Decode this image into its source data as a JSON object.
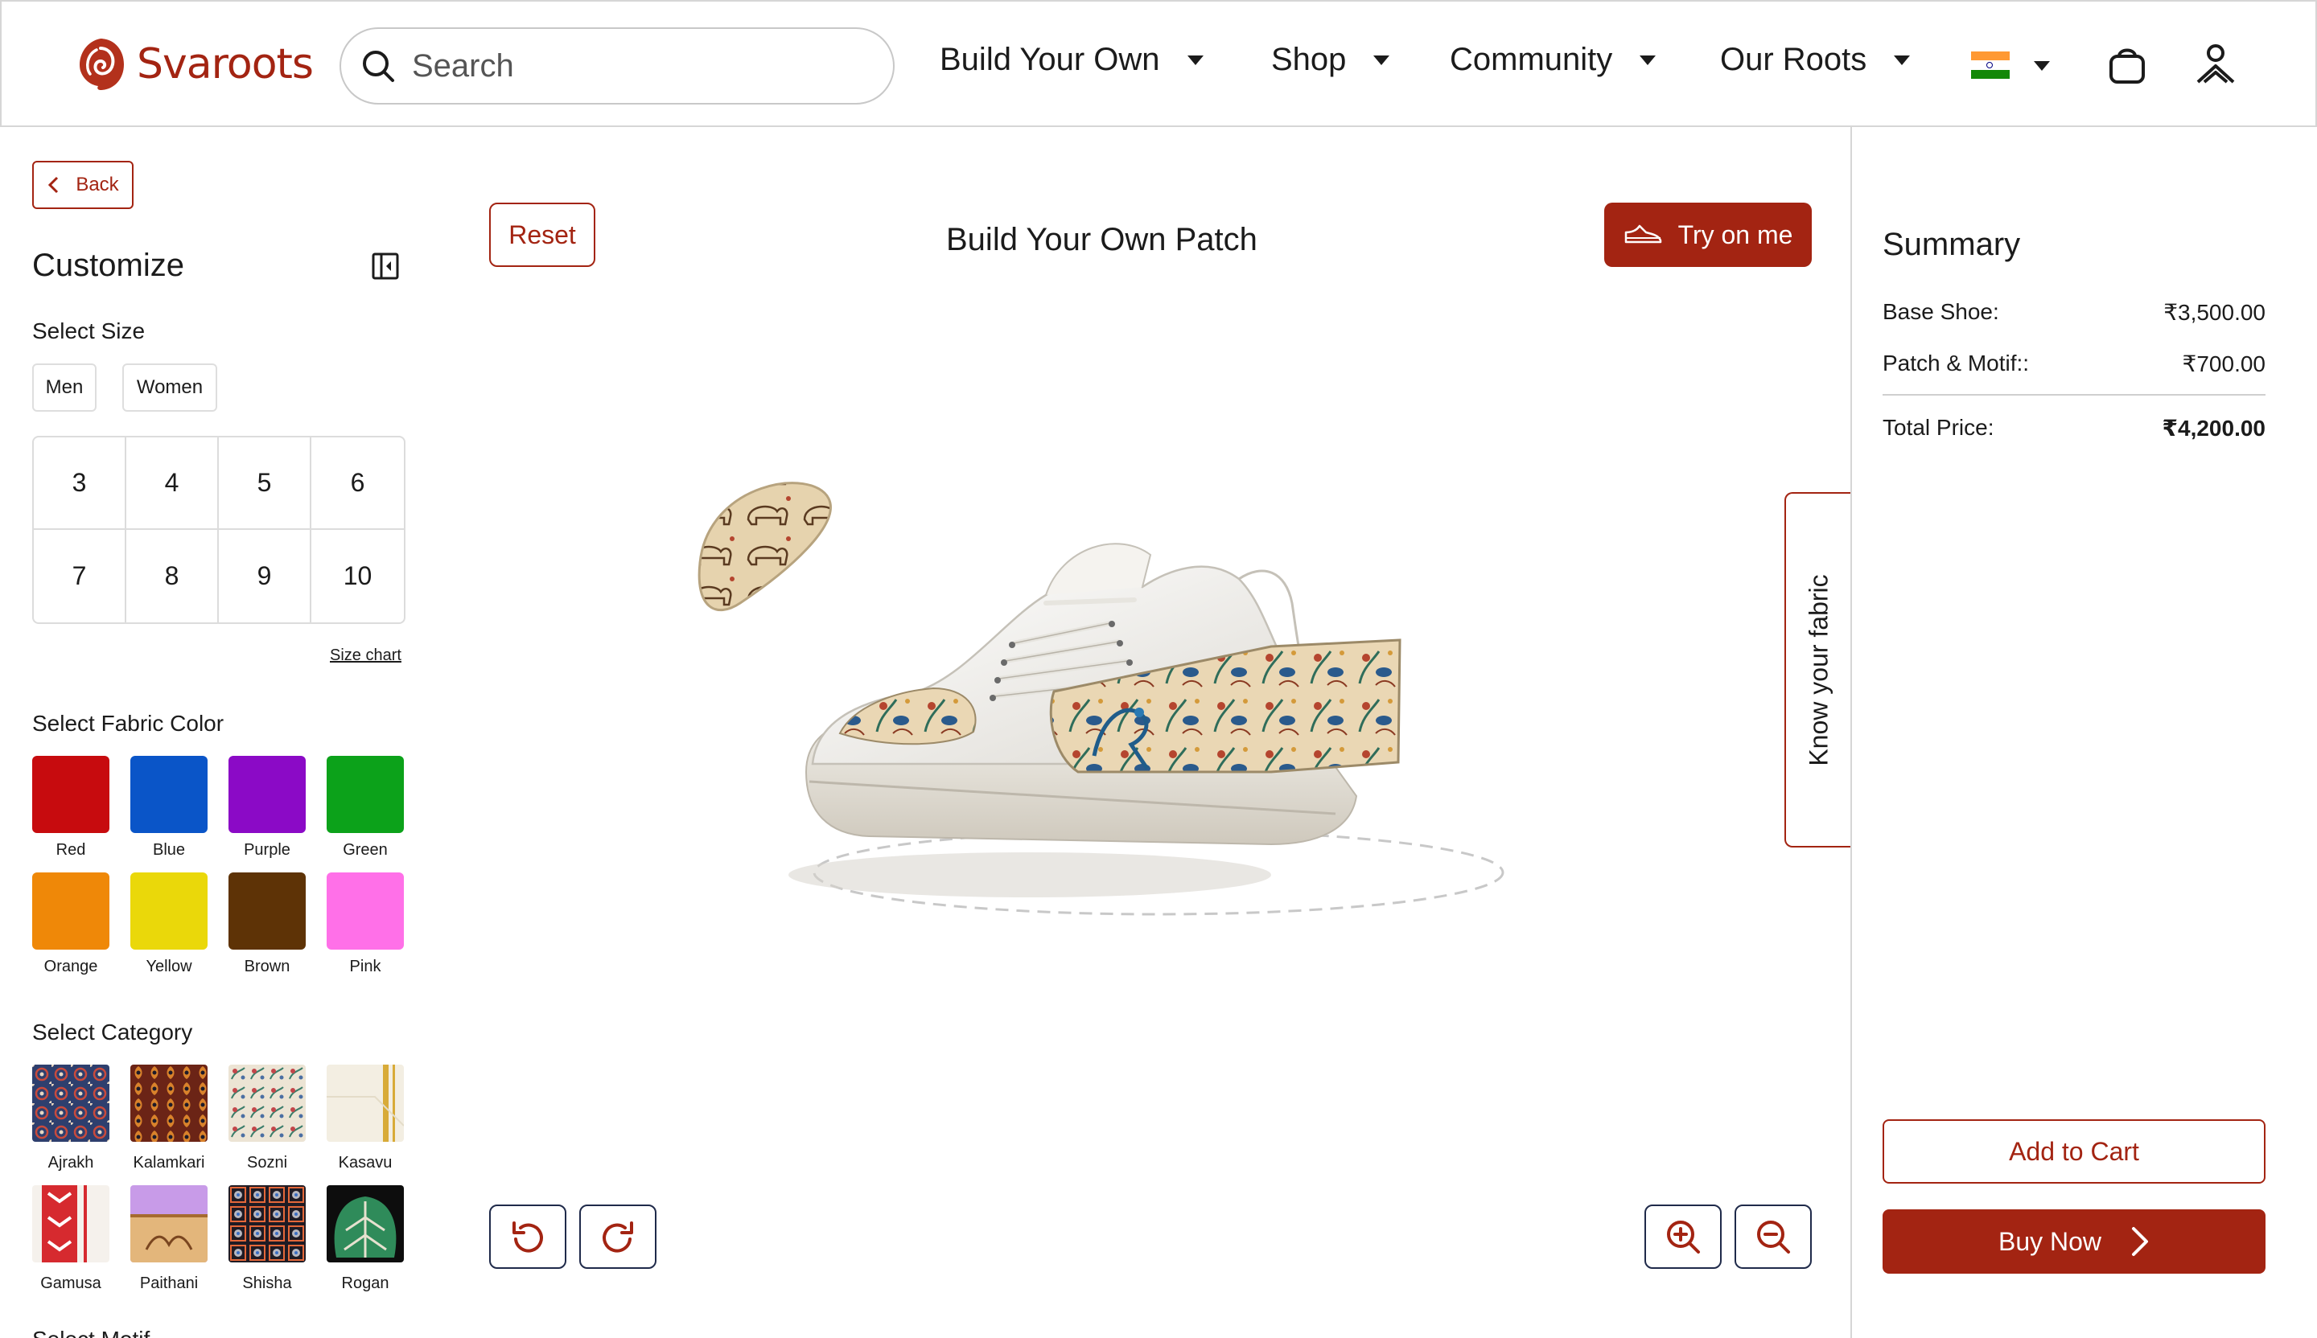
{
  "header": {
    "brand": "Svaroots",
    "search_placeholder": "Search",
    "nav": [
      {
        "label": "Build Your Own",
        "icon": "chevron-down-icon"
      },
      {
        "label": "Shop",
        "icon": "chevron-down-icon"
      },
      {
        "label": "Community",
        "icon": "chevron-down-icon"
      },
      {
        "label": "Our Roots",
        "icon": "chevron-down-icon"
      }
    ],
    "country_flag": "india-flag-icon",
    "icons": [
      "shopping-bag-icon",
      "user-icon"
    ]
  },
  "left_panel": {
    "back_label": "Back",
    "title": "Customize",
    "select_size_label": "Select Size",
    "gender_options": [
      "Men",
      "Women"
    ],
    "sizes": [
      "3",
      "4",
      "5",
      "6",
      "7",
      "8",
      "9",
      "10"
    ],
    "size_chart_label": "Size chart",
    "fabric_color_label": "Select Fabric Color",
    "fabric_colors": [
      {
        "name": "Red",
        "hex": "#c70b0e"
      },
      {
        "name": "Blue",
        "hex": "#0a55c8"
      },
      {
        "name": "Purple",
        "hex": "#8b0ac6"
      },
      {
        "name": "Green",
        "hex": "#0ca21a"
      },
      {
        "name": "Orange",
        "hex": "#ef8808"
      },
      {
        "name": "Yellow",
        "hex": "#ead80a"
      },
      {
        "name": "Brown",
        "hex": "#5e3306"
      },
      {
        "name": "Pink",
        "hex": "#ff70e8"
      }
    ],
    "category_label": "Select Category",
    "categories": [
      "Ajrakh",
      "Kalamkari",
      "Sozni",
      "Kasavu",
      "Gamusa",
      "Paithani",
      "Shisha",
      "Rogan"
    ],
    "motif_label": "Select Motif"
  },
  "center": {
    "reset_label": "Reset",
    "title": "Build Your Own Patch",
    "try_on_label": "Try on me",
    "know_fabric_label": "Know your fabric",
    "controls": [
      "rotate-left-icon",
      "rotate-right-icon",
      "zoom-in-icon",
      "zoom-out-icon"
    ]
  },
  "summary": {
    "title": "Summary",
    "rows": [
      {
        "label": "Base Shoe:",
        "value": "₹3,500.00"
      },
      {
        "label": "Patch & Motif::",
        "value": "₹700.00"
      }
    ],
    "total_label": "Total Price:",
    "total_value": "₹4,200.00",
    "add_to_cart_label": "Add to Cart",
    "buy_now_label": "Buy Now"
  },
  "colors": {
    "accent": "#a32412",
    "control_border": "#1f2a4a"
  }
}
